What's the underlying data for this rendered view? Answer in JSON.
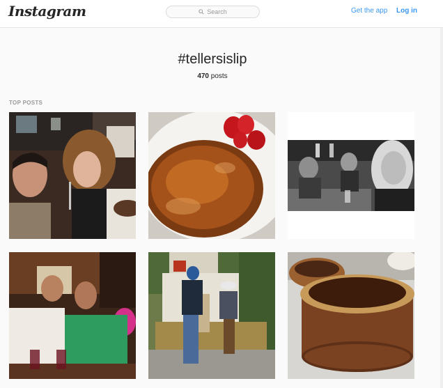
{
  "header": {
    "logo": "Instagram",
    "search_placeholder": "Search",
    "get_app_label": "Get the app",
    "login_label": "Log in"
  },
  "tag": {
    "title": "#tellersislip",
    "post_count": "470",
    "post_count_suffix": " posts"
  },
  "section_label": "TOP POSTS",
  "posts": [
    {
      "icon": "couple-selfie-restaurant-photo"
    },
    {
      "icon": "creme-brulee-strawberries-photo"
    },
    {
      "icon": "black-and-white-bar-selfie-photo"
    },
    {
      "icon": "two-men-restaurant-photo"
    },
    {
      "icon": "couple-bench-sign-photo"
    },
    {
      "icon": "chocolate-pie-photo"
    }
  ],
  "colors": {
    "link_blue": "#3897f0",
    "background": "#fafafa"
  }
}
